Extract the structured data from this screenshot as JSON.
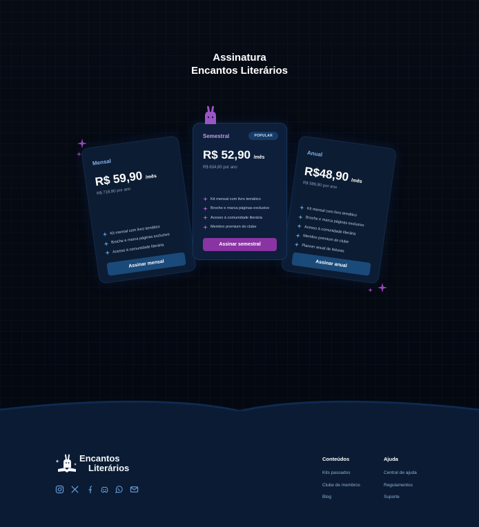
{
  "title": {
    "line1": "Assinatura",
    "line2": "Encantos Literários"
  },
  "plans": {
    "mensal": {
      "name": "Mensal",
      "price": "R$ 59,90",
      "per": "/mês",
      "yearly": "R$ 718,80 por ano",
      "features": [
        "Kit mensal com livro temático",
        "Broche e marca páginas exclusivo",
        "Acesso à comunidade literária"
      ],
      "cta": "Assinar mensal"
    },
    "semestral": {
      "name": "Semestral",
      "badge": "POPULAR",
      "price": "R$ 52,90",
      "per": "/mês",
      "yearly": "R$ 634,80 por ano",
      "features": [
        "Kit mensal com livro temático",
        "Broche e marca páginas exclusivo",
        "Acesso à comunidade literária",
        "Membro premium do clube"
      ],
      "cta": "Assinar semestral"
    },
    "anual": {
      "name": "Anual",
      "price": "R$48,90",
      "per": "/mês",
      "yearly": "R$ 586,80 por ano",
      "features": [
        "Kit mensal com livro temático",
        "Broche e marca páginas exclusivo",
        "Acesso à comunidade literária",
        "Membro premium do clube",
        "Planner anual de leituras"
      ],
      "cta": "Assinar anual"
    }
  },
  "footer": {
    "logo": {
      "line1": "Encantos",
      "line2": "Literários"
    },
    "socials": [
      "instagram-icon",
      "x-icon",
      "facebook-icon",
      "discord-icon",
      "whatsapp-icon",
      "mail-icon"
    ],
    "conteudos": {
      "heading": "Conteúdos",
      "links": [
        "Kits passados",
        "Clube de membros",
        "Blog"
      ]
    },
    "ajuda": {
      "heading": "Ajuda",
      "links": [
        "Central de ajuda",
        "Regulamentos",
        "Suporte"
      ]
    }
  },
  "colors": {
    "background": "#050912",
    "footer": "#0a1b33",
    "card": "#0c1c33",
    "accent_purple": "#8a34a4",
    "accent_blue": "#1a4a7a",
    "feature_spark_blue": "#5ea2e6",
    "feature_spark_purple": "#b05cd0"
  }
}
